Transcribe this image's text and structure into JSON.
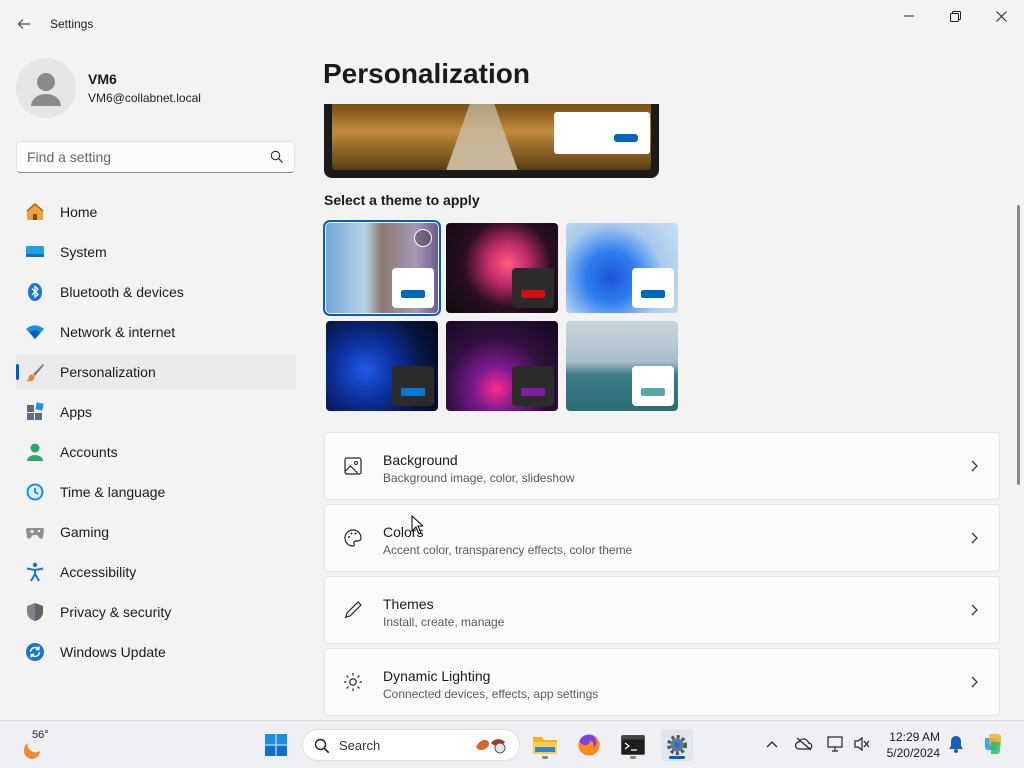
{
  "window": {
    "title": "Settings"
  },
  "profile": {
    "name": "VM6",
    "email": "VM6@collabnet.local"
  },
  "search": {
    "placeholder": "Find a setting"
  },
  "nav": {
    "items": [
      {
        "label": "Home",
        "icon": "home-icon"
      },
      {
        "label": "System",
        "icon": "system-icon"
      },
      {
        "label": "Bluetooth & devices",
        "icon": "bluetooth-icon"
      },
      {
        "label": "Network & internet",
        "icon": "network-icon"
      },
      {
        "label": "Personalization",
        "icon": "brush-icon",
        "active": true
      },
      {
        "label": "Apps",
        "icon": "apps-icon"
      },
      {
        "label": "Accounts",
        "icon": "accounts-icon"
      },
      {
        "label": "Time & language",
        "icon": "clock-icon"
      },
      {
        "label": "Gaming",
        "icon": "gamepad-icon"
      },
      {
        "label": "Accessibility",
        "icon": "accessibility-icon"
      },
      {
        "label": "Privacy & security",
        "icon": "shield-icon"
      },
      {
        "label": "Windows Update",
        "icon": "update-icon"
      }
    ]
  },
  "page": {
    "title": "Personalization",
    "themes_label": "Select a theme to apply",
    "themes": [
      {
        "name": "theme-1",
        "selected": true,
        "window": "light",
        "accent": "#0067c0"
      },
      {
        "name": "theme-2",
        "window": "dark",
        "accent": "#d40d12"
      },
      {
        "name": "theme-3",
        "window": "light",
        "accent": "#0067c0"
      },
      {
        "name": "theme-4",
        "window": "dark",
        "accent": "#0078d4"
      },
      {
        "name": "theme-5",
        "window": "dark",
        "accent": "#7b1fa2"
      },
      {
        "name": "theme-6",
        "window": "light",
        "accent": "#5aa6a8"
      }
    ],
    "cards": [
      {
        "title": "Background",
        "subtitle": "Background image, color, slideshow",
        "icon": "image-icon"
      },
      {
        "title": "Colors",
        "subtitle": "Accent color, transparency effects, color theme",
        "icon": "palette-icon"
      },
      {
        "title": "Themes",
        "subtitle": "Install, create, manage",
        "icon": "pen-icon"
      },
      {
        "title": "Dynamic Lighting",
        "subtitle": "Connected devices, effects, app settings",
        "icon": "lighting-icon"
      }
    ]
  },
  "taskbar": {
    "weather_temp": "56°",
    "search_label": "Search",
    "time": "12:29 AM",
    "date": "5/20/2024"
  },
  "colors": {
    "accent": "#005fb8",
    "background": "#f3f3f3"
  }
}
